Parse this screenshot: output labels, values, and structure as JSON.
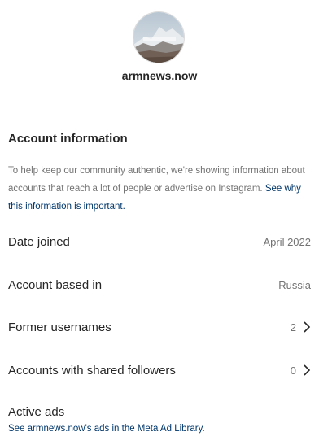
{
  "profile": {
    "username": "armnews.now",
    "avatar_text": "Mountain logo"
  },
  "account_info": {
    "title": "Account information",
    "description": "To help keep our community authentic, we're showing information about accounts that reach a lot of people or advertise on Instagram.",
    "why_link": "See why this information is important."
  },
  "rows": [
    {
      "label": "Date joined",
      "value": "April 2022",
      "chevron": false
    },
    {
      "label": "Account based in",
      "value": "Russia",
      "chevron": false
    },
    {
      "label": "Former usernames",
      "value": "2",
      "chevron": true
    },
    {
      "label": "Accounts with shared followers",
      "value": "0",
      "chevron": true
    }
  ],
  "ads": {
    "label": "Active ads",
    "link": "See armnews.now's ads in the Meta Ad Library."
  },
  "colors": {
    "text_primary": "#262626",
    "text_secondary": "#737373",
    "link": "#00376b",
    "divider": "#dbdbdb"
  }
}
